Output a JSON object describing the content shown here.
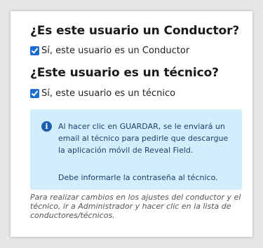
{
  "driver_section": {
    "question": "¿Es este usuario un Conductor?",
    "checkbox_label": "Sí, este usuario es un Conductor",
    "checked": true
  },
  "technician_section": {
    "question": "¿Este usuario es un técnico?",
    "checkbox_label": "Sí, este usuario es un técnico",
    "checked": true
  },
  "info": {
    "icon": "info-icon",
    "glyph": "i",
    "message": "Al hacer clic en GUARDAR, se le enviará un email al técnico para pedirle que descargue la aplicación móvil de Reveal Field.",
    "password_note": "Debe informarle la contraseña al técnico."
  },
  "footnote": "Para realizar cambios en los ajustes del conductor y el técnico, ir a Administrador y hacer clic en la lista de conductores/técnicos.",
  "colors": {
    "checkbox": "#1b6ed1",
    "info_background": "#d2edfc",
    "info_icon": "#1d5eae",
    "info_text": "#1a3f6b"
  }
}
